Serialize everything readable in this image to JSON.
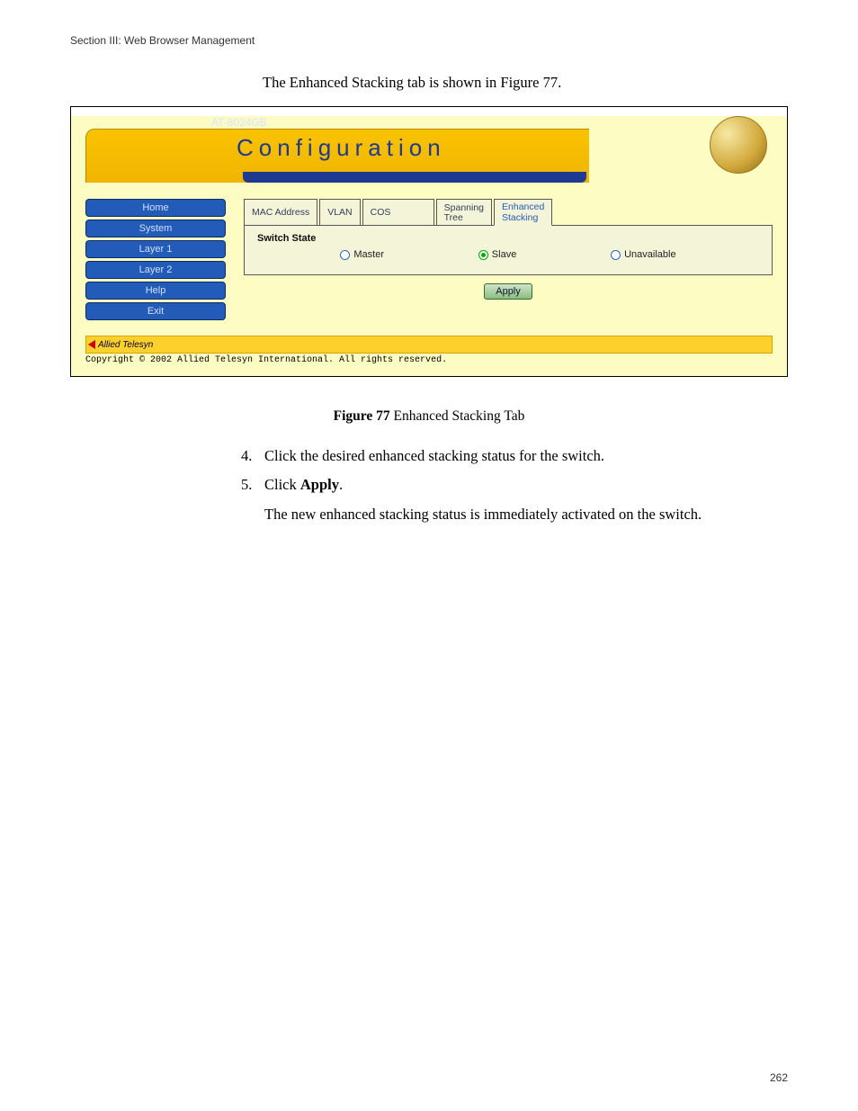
{
  "header": {
    "section_label": "Section III: Web Browser Management"
  },
  "intro": {
    "text": "The Enhanced Stacking tab is shown in Figure 77."
  },
  "device": {
    "model": "AT-8024GB"
  },
  "banner": {
    "title": "Configuration"
  },
  "sidebar": {
    "items": [
      {
        "label": "Home"
      },
      {
        "label": "System"
      },
      {
        "label": "Layer 1"
      },
      {
        "label": "Layer 2"
      },
      {
        "label": "Help"
      },
      {
        "label": "Exit"
      }
    ]
  },
  "tabs": {
    "items": [
      {
        "label": "MAC Address"
      },
      {
        "label": "VLAN"
      },
      {
        "label": "COS"
      },
      {
        "label": "Spanning\nTree"
      },
      {
        "label": "Enhanced\nStacking"
      }
    ],
    "active_index": 4
  },
  "panel": {
    "group_label": "Switch State",
    "options": [
      {
        "label": "Master",
        "selected": false
      },
      {
        "label": "Slave",
        "selected": true
      },
      {
        "label": "Unavailable",
        "selected": false
      }
    ],
    "apply_label": "Apply"
  },
  "footer": {
    "logo_text": "Allied Telesyn",
    "copyright": "Copyright © 2002 Allied Telesyn International. All rights reserved."
  },
  "caption": {
    "bold": "Figure 77",
    "rest": "  Enhanced Stacking Tab"
  },
  "steps": {
    "s4_num": "4.",
    "s4_text": "Click the desired enhanced stacking status for the switch.",
    "s5_num": "5.",
    "s5_pre": "Click ",
    "s5_bold": "Apply",
    "s5_post": ".",
    "s5_sub": "The new enhanced stacking status is immediately activated on the switch."
  },
  "page": {
    "number": "262"
  }
}
